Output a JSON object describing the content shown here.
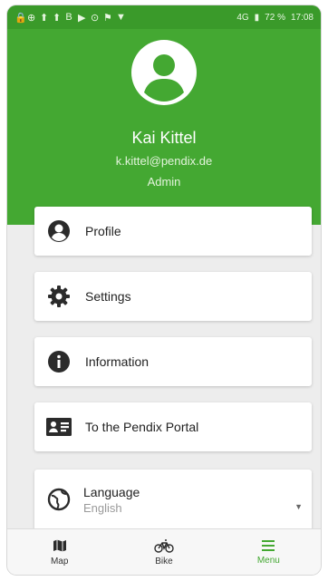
{
  "statusbar": {
    "left_icons": [
      "🔒",
      "⊕",
      "⬆",
      "⬆",
      "B",
      "▶",
      "⊙",
      "⚑",
      "▼"
    ],
    "network": "4G",
    "battery": "72 %",
    "time": "17:08"
  },
  "user": {
    "name": "Kai Kittel",
    "email": "k.kittel@pendix.de",
    "role": "Admin"
  },
  "menu": {
    "profile": "Profile",
    "settings": "Settings",
    "information": "Information",
    "portal": "To the Pendix Portal",
    "language_title": "Language",
    "language_value": "English"
  },
  "nav": {
    "map": "Map",
    "bike": "Bike",
    "menu": "Menu"
  },
  "colors": {
    "primary": "#44a832",
    "icon": "#2b2b2b"
  }
}
